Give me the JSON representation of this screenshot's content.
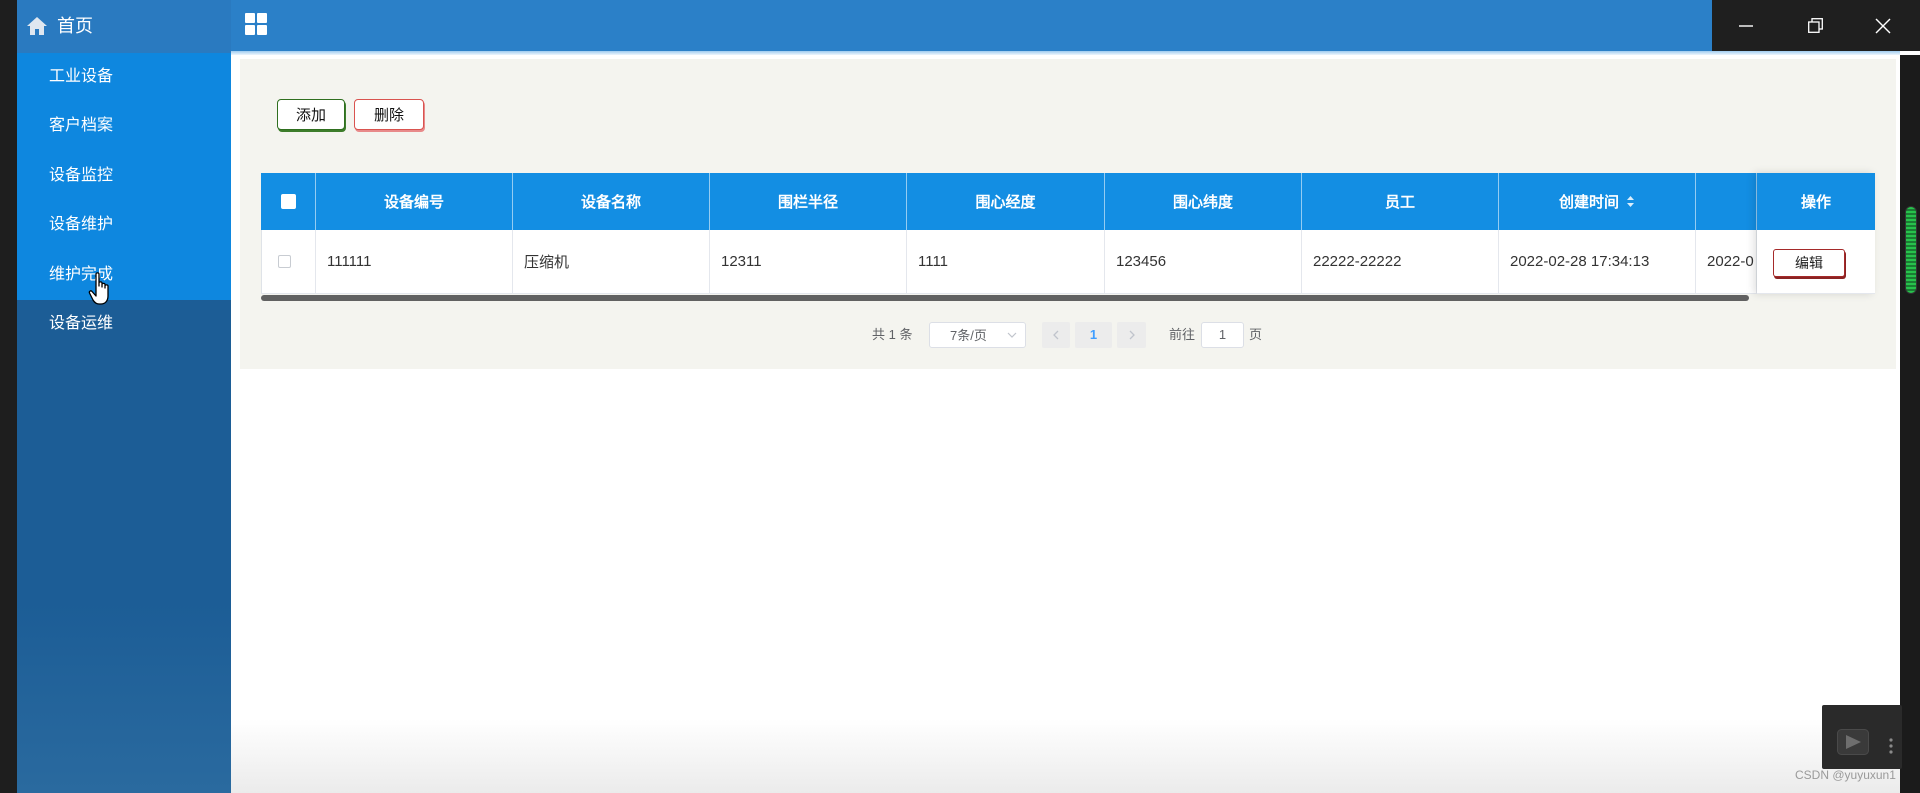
{
  "sidebar": {
    "header": {
      "icon": "home-icon",
      "label": "首页"
    },
    "items": [
      {
        "label": "工业设备"
      },
      {
        "label": "客户档案"
      },
      {
        "label": "设备监控"
      },
      {
        "label": "设备维护"
      },
      {
        "label": "维护完成"
      },
      {
        "label": "设备运维"
      }
    ]
  },
  "topbar": {
    "menu_icon": "grid-icon"
  },
  "window_controls": {
    "icons": [
      "minimize-icon",
      "restore-icon",
      "close-icon"
    ]
  },
  "toolbar": {
    "add_label": "添加",
    "delete_label": "删除"
  },
  "table": {
    "select_all_icon": "checkbox-icon",
    "sort_icon": "sort-caret-icon",
    "columns": {
      "code": "设备编号",
      "name": "设备名称",
      "radius": "围栏半径",
      "longitude": "围心经度",
      "latitude": "围心纬度",
      "employee": "员工",
      "created": "创建时间",
      "actions": "操作"
    },
    "rows": [
      {
        "code": "111111",
        "name": "压缩机",
        "radius": "12311",
        "longitude": "1111",
        "latitude": "123456",
        "employee": "22222-22222",
        "created": "2022-02-28 17:34:13",
        "clipped_col": "2022-0",
        "action_label": "编辑"
      }
    ]
  },
  "pagination": {
    "total": "共 1 条",
    "page_size": "7条/页",
    "current_page": "1",
    "goto_label": "前往",
    "goto_value": "1",
    "page_suffix": "页"
  },
  "watermark": "CSDN @yuyuxun1",
  "colors": {
    "sidebar_bg": "#1c5d96",
    "sidebar_submenu_bg": "#0e87df",
    "topbar_bg": "#2b80c8",
    "table_header_bg": "#138ee3",
    "add_border": "#2f6f1f",
    "delete_border": "#d9534f",
    "edit_border": "#a52a2a",
    "page_active": "#409eff",
    "panel_bg": "#f4f4ef"
  }
}
